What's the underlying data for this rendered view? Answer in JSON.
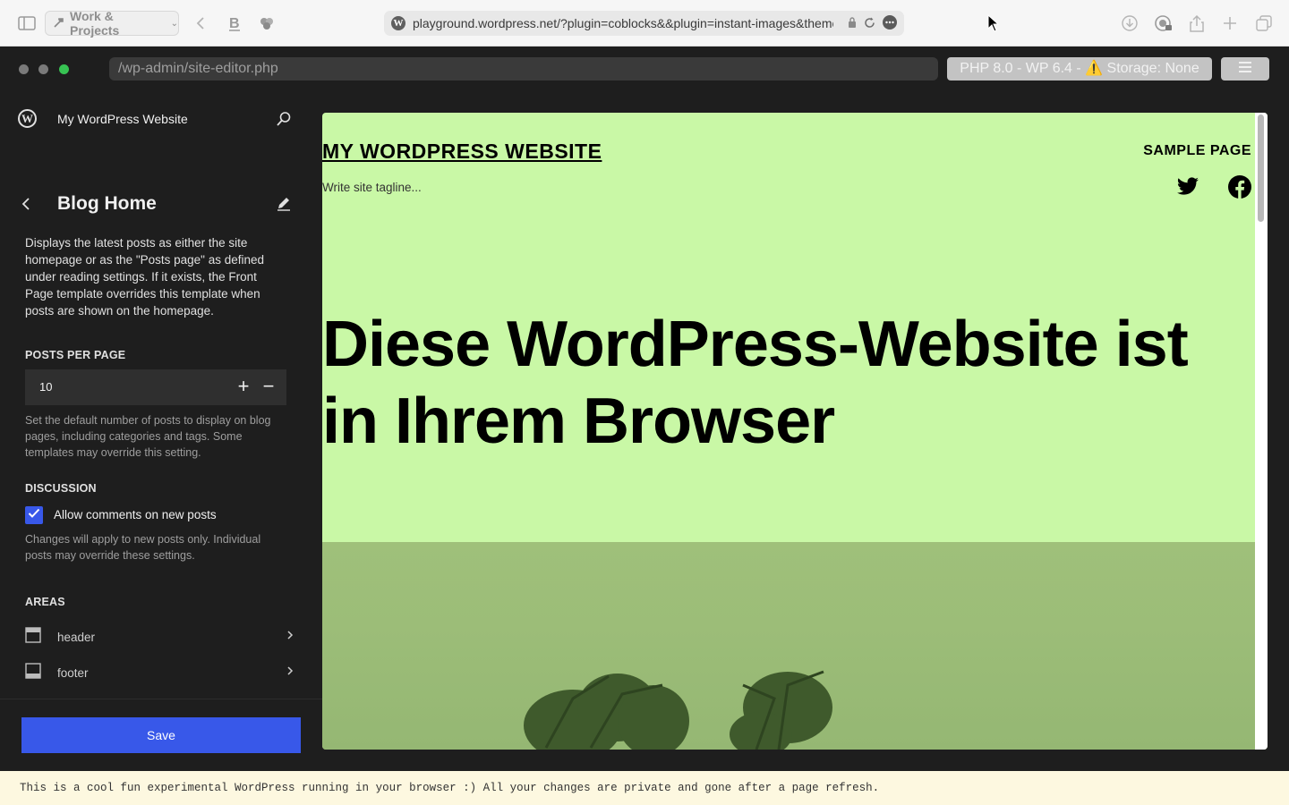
{
  "browser": {
    "tab_group_label": "Work & Projects",
    "url": "playground.wordpress.net/?plugin=coblocks&&plugin=instant-images&theme="
  },
  "playground": {
    "path": "/wp-admin/site-editor.php",
    "info": "PHP 8.0 - WP 6.4 - ⚠️ Storage: None"
  },
  "sidebar": {
    "site_name": "My WordPress Website",
    "title": "Blog Home",
    "description": "Displays the latest posts as either the site homepage or as the \"Posts page\" as defined under reading settings. If it exists, the Front Page template overrides this template when posts are shown on the homepage.",
    "posts_per_page": {
      "label": "POSTS PER PAGE",
      "value": "10",
      "help": "Set the default number of posts to display on blog pages, including categories and tags. Some templates may override this setting."
    },
    "discussion": {
      "label": "DISCUSSION",
      "checkbox_label": "Allow comments on new posts",
      "checked": true,
      "help": "Changes will apply to new posts only. Individual posts may override these settings."
    },
    "areas": {
      "label": "AREAS",
      "items": [
        {
          "label": "header"
        },
        {
          "label": "footer"
        }
      ]
    },
    "save_label": "Save"
  },
  "canvas": {
    "site_title": "MY WORDPRESS WEBSITE",
    "tagline": "Write site tagline...",
    "nav_item": "SAMPLE PAGE",
    "heading": "Diese WordPress-Website ist in Ihrem Browser"
  },
  "notice": "This is a cool fun experimental WordPress running in your browser :) All your changes are private and gone after a page refresh.",
  "colors": {
    "accent": "#3858e9",
    "canvas_background": "#c9f8a6",
    "sidebar_background": "#1e1e1e",
    "notice_background": "#fdf8e0"
  }
}
